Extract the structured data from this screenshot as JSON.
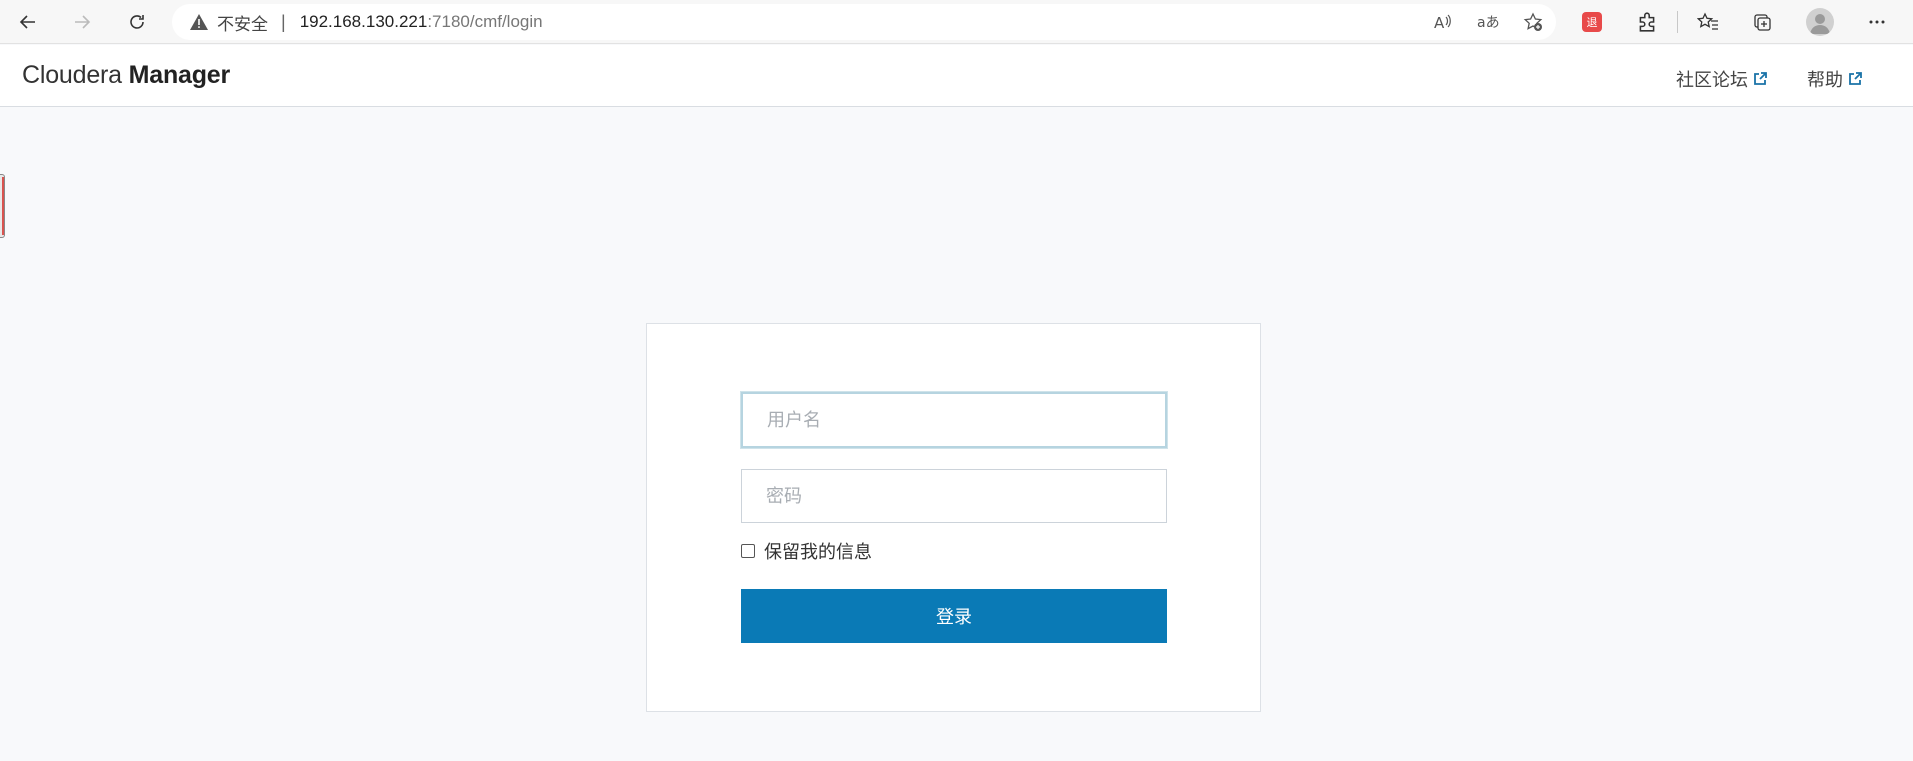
{
  "browser": {
    "security_label": "不安全",
    "url_host": "192.168.130.221",
    "url_rest": ":7180/cmf/login",
    "extension_badge": "退",
    "icons": [
      "back-arrow-icon",
      "forward-arrow-icon",
      "reload-icon",
      "warning-triangle-icon",
      "read-aloud-icon",
      "translate-icon",
      "add-favorite-icon",
      "extension-icon",
      "puzzle-extensions-icon",
      "favorites-icon",
      "collections-icon",
      "profile-avatar-icon",
      "more-menu-icon"
    ]
  },
  "app": {
    "brand_light": "Cloudera",
    "brand_bold": "Manager",
    "links": [
      {
        "label": "社区论坛"
      },
      {
        "label": "帮助"
      }
    ]
  },
  "login": {
    "username_placeholder": "用户名",
    "password_placeholder": "密码",
    "remember_label": "保留我的信息",
    "submit_label": "登录"
  },
  "colors": {
    "primary": "#0a7ab6",
    "page_bg": "#f8f9fb",
    "link_icon": "#1a73a8",
    "badge_red": "#e84a4a"
  }
}
